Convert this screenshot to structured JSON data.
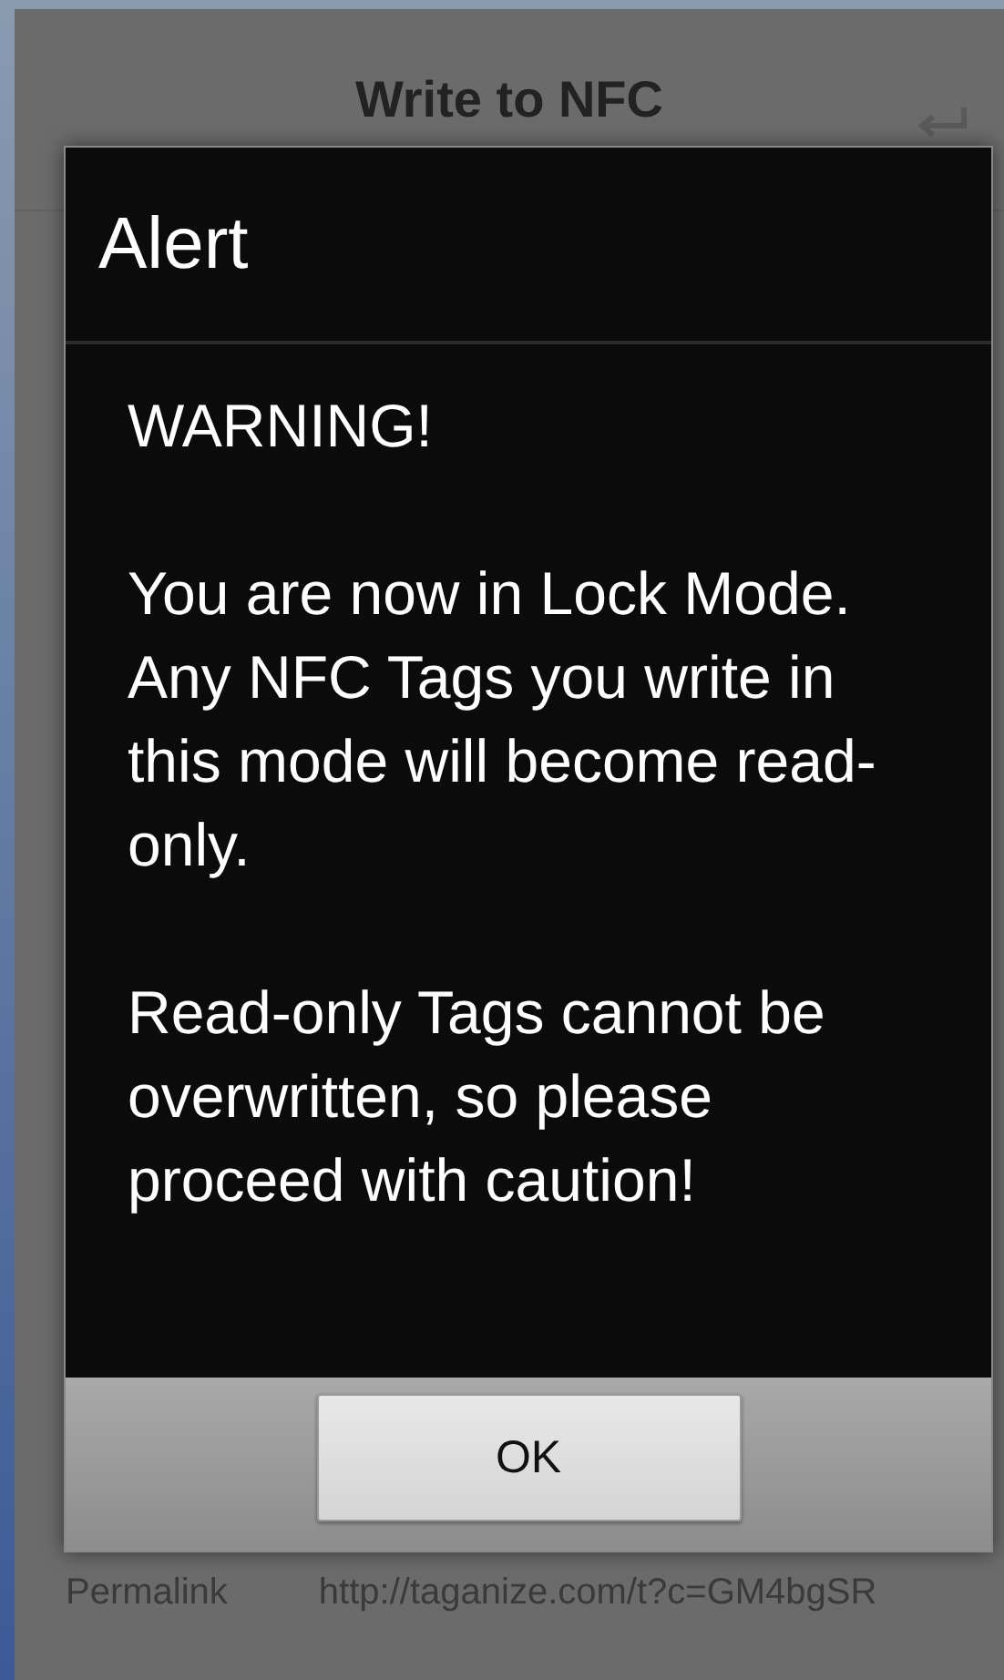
{
  "screen": {
    "title": "Write to NFC",
    "permalink_label": "Permalink",
    "permalink_url": "http://taganize.com/t?c=GM4bgSR"
  },
  "dialog": {
    "title": "Alert",
    "paragraphs": [
      "WARNING!",
      "You are now in Lock Mode. Any NFC Tags you write in this mode will become read-only.",
      "Read-only Tags cannot be overwritten, so please proceed with caution!"
    ],
    "buttons": [
      "OK"
    ]
  }
}
